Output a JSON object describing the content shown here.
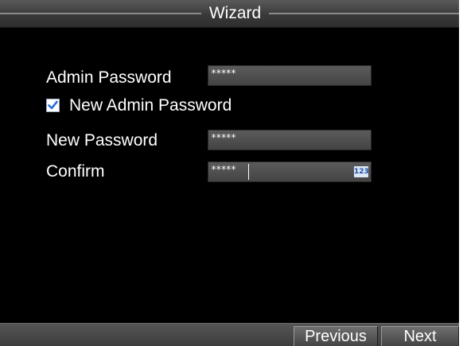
{
  "window": {
    "title": "Wizard"
  },
  "form": {
    "admin_password_label": "Admin Password",
    "admin_password_value": "*****",
    "new_admin_password_checkbox_label": "New Admin Password",
    "new_admin_password_checked": true,
    "new_password_label": "New Password",
    "new_password_value": "*****",
    "confirm_label": "Confirm",
    "confirm_value": "*****",
    "input_mode_badge": "123"
  },
  "buttons": {
    "previous_label": "Previous",
    "next_label": "Next"
  },
  "colors": {
    "background": "#000000",
    "field": "#4f4f4f",
    "checkbox_check": "#2a6fd6",
    "text": "#ffffff"
  },
  "icons": {
    "checkbox": "checkmark-icon",
    "input_mode": "numeric-input-mode-icon"
  }
}
